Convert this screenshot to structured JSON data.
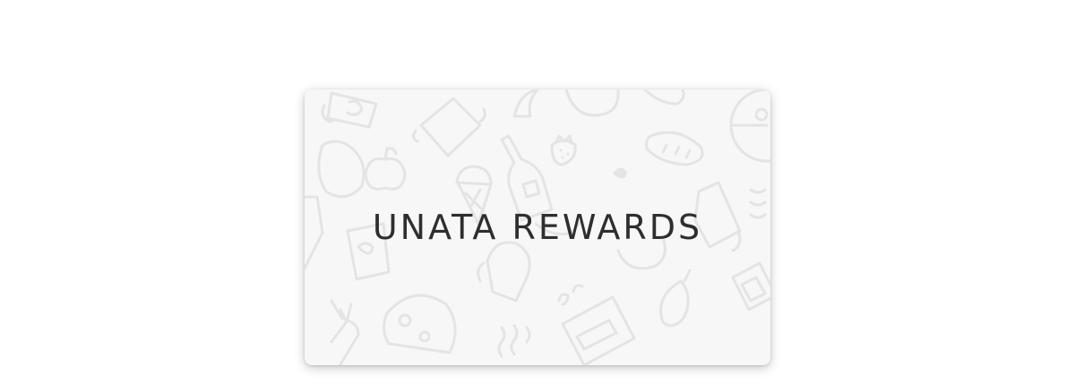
{
  "card": {
    "title": "UNATA REWARDS",
    "background": "#f7f7f7",
    "pattern_color": "#e4e4e4",
    "text_color": "#2e2e2e"
  }
}
